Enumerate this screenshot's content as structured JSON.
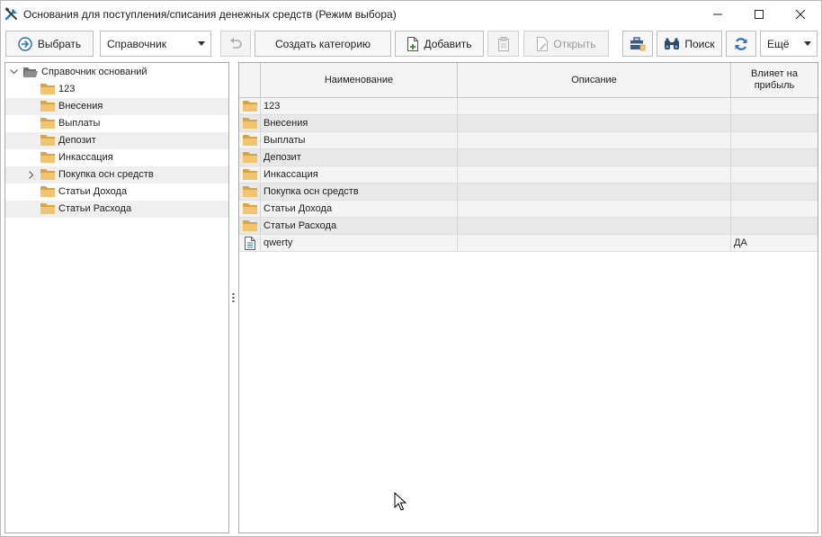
{
  "window": {
    "title": "Основания для поступления/списания денежных средств (Режим выбора)"
  },
  "toolbar": {
    "select_label": "Выбрать",
    "reference_dropdown": "Справочник",
    "create_category_label": "Создать категорию",
    "add_label": "Добавить",
    "open_label": "Открыть",
    "search_label": "Поиск",
    "more_dropdown": "Ещё"
  },
  "tree": {
    "root_label": "Справочник оснований",
    "items": [
      {
        "label": "123",
        "expandable": false
      },
      {
        "label": "Внесения",
        "expandable": false
      },
      {
        "label": "Выплаты",
        "expandable": false
      },
      {
        "label": "Депозит",
        "expandable": false
      },
      {
        "label": "Инкассация",
        "expandable": false
      },
      {
        "label": "Покупка осн средств",
        "expandable": true
      },
      {
        "label": "Статьи Дохода",
        "expandable": false
      },
      {
        "label": "Статьи Расхода",
        "expandable": false
      }
    ]
  },
  "grid": {
    "columns": {
      "name": "Наименование",
      "description": "Описание",
      "profit_line1": "Влияет на",
      "profit_line2": "прибыль"
    },
    "rows": [
      {
        "type": "folder",
        "name": "123",
        "description": "",
        "profit": ""
      },
      {
        "type": "folder",
        "name": "Внесения",
        "description": "",
        "profit": ""
      },
      {
        "type": "folder",
        "name": "Выплаты",
        "description": "",
        "profit": ""
      },
      {
        "type": "folder",
        "name": "Депозит",
        "description": "",
        "profit": ""
      },
      {
        "type": "folder",
        "name": "Инкассация",
        "description": "",
        "profit": ""
      },
      {
        "type": "folder",
        "name": "Покупка осн средств",
        "description": "",
        "profit": ""
      },
      {
        "type": "folder",
        "name": "Статьи Дохода",
        "description": "",
        "profit": ""
      },
      {
        "type": "folder",
        "name": "Статьи Расхода",
        "description": "",
        "profit": ""
      },
      {
        "type": "document",
        "name": "qwerty",
        "description": "",
        "profit": "ДА"
      }
    ]
  },
  "colors": {
    "folder": "#f2c46d",
    "folder_dark": "#d9a441",
    "accent_blue": "#2b73c2",
    "row_alt": "#e8e8e8"
  }
}
